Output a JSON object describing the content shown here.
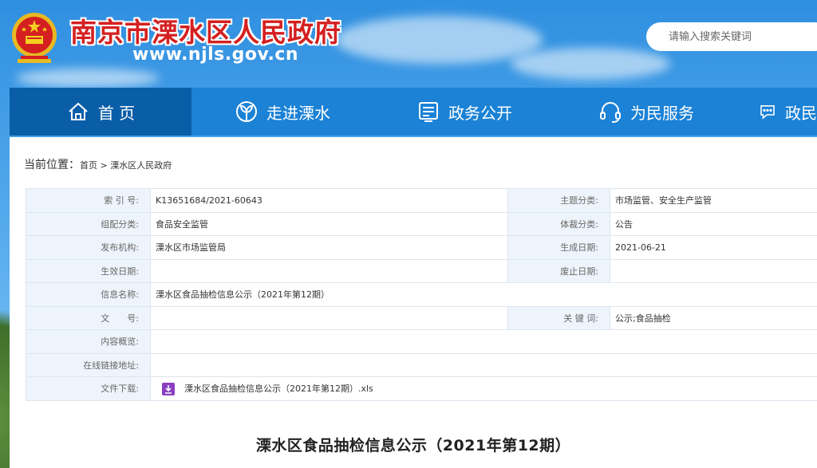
{
  "header": {
    "site_title": "南京市溧水区人民政府",
    "site_url": "www.njls.gov.cn",
    "search_placeholder": "请输入搜索关键词"
  },
  "nav": {
    "items": [
      {
        "label": "首 页",
        "icon": "home-icon",
        "active": true
      },
      {
        "label": "走进溧水",
        "icon": "leaf-icon",
        "active": false
      },
      {
        "label": "政务公开",
        "icon": "document-icon",
        "active": false
      },
      {
        "label": "为民服务",
        "icon": "headset-icon",
        "active": false
      },
      {
        "label": "政民",
        "icon": "chat-icon",
        "active": false
      }
    ]
  },
  "breadcrumb": {
    "prefix": "当前位置：",
    "home": "首页",
    "sep": " > ",
    "current": "溧水区人民政府"
  },
  "meta": {
    "rows": [
      {
        "k1": "索 引 号:",
        "v1": "K13651684/2021-60643",
        "k2": "主题分类:",
        "v2": "市场监管、安全生产监管"
      },
      {
        "k1": "组配分类:",
        "v1": "食品安全监管",
        "k2": "体裁分类:",
        "v2": "公告"
      },
      {
        "k1": "发布机构:",
        "v1": "溧水区市场监管局",
        "k2": "生成日期:",
        "v2": "2021-06-21"
      },
      {
        "k1": "生效日期:",
        "v1": "",
        "k2": "废止日期:",
        "v2": ""
      }
    ],
    "info_name_key": "信息名称:",
    "info_name_value": "溧水区食品抽检信息公示（2021年第12期）",
    "doc_no_key": "文　　号:",
    "doc_no_value": "",
    "keywords_key": "关 键 词:",
    "keywords_value": "公示;食品抽检",
    "summary_key": "内容概览:",
    "summary_value": "",
    "link_key": "在线链接地址:",
    "link_value": "",
    "download_key": "文件下载:",
    "download_file": "溧水区食品抽检信息公示（2021年第12期）.xls"
  },
  "doc_title": "溧水区食品抽检信息公示（2021年第12期）",
  "colors": {
    "nav_bg": "#1b82d6",
    "nav_active": "#0a5ea8",
    "title_red": "#d42020",
    "download_purple": "#8a3fc0"
  }
}
